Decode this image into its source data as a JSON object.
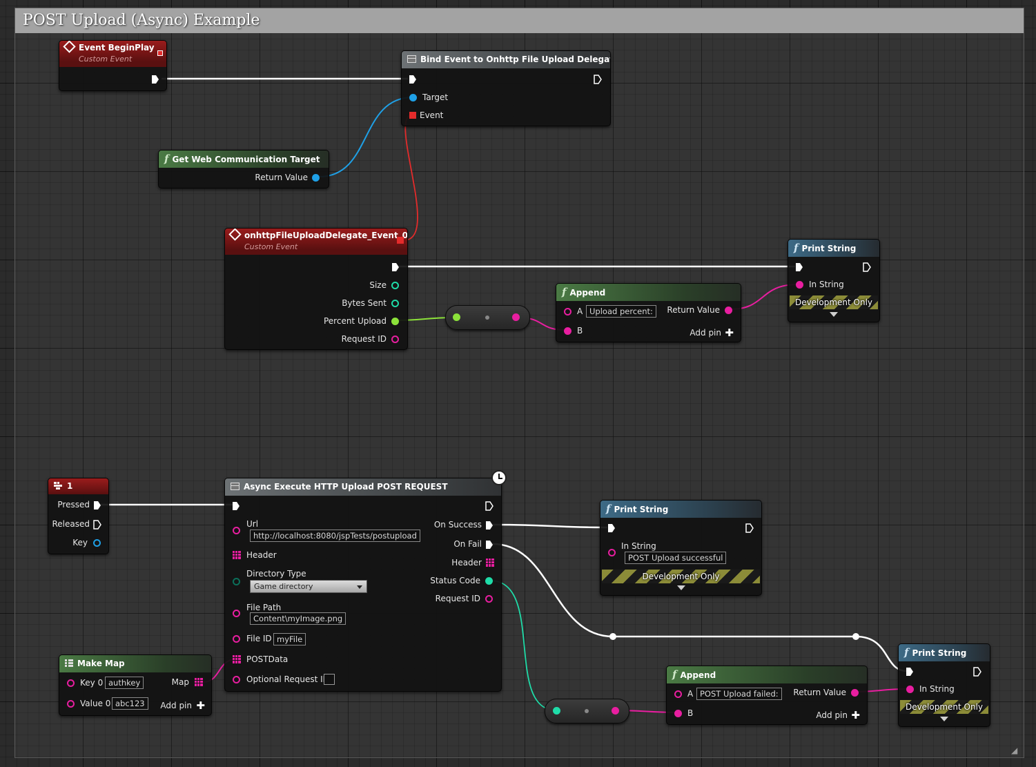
{
  "comment": {
    "title": "POST Upload (Async) Example"
  },
  "colors": {
    "exec": "#ffffff",
    "object": "#1fa0e6",
    "delegate": "#e42b2b",
    "float": "#8ce23a",
    "string": "#e81ea0",
    "integer": "#1fdca8"
  },
  "event_beginplay": {
    "title": "Event BeginPlay",
    "subtitle": "Custom Event"
  },
  "bind_event": {
    "title": "Bind Event to Onhttp File Upload Delegate",
    "target_label": "Target",
    "event_label": "Event"
  },
  "get_target": {
    "title": "Get Web Communication Target",
    "return_label": "Return Value"
  },
  "upload_event": {
    "title": "onhttpFileUploadDelegate_Event_0",
    "subtitle": "Custom Event",
    "pins": {
      "size": "Size",
      "bytes_sent": "Bytes Sent",
      "percent": "Percent Upload",
      "request_id": "Request ID"
    }
  },
  "append_top": {
    "title": "Append",
    "a_label": "A",
    "a_value": "Upload percent:",
    "b_label": "B",
    "return_label": "Return Value",
    "add_pin": "Add pin"
  },
  "print_top": {
    "title": "Print String",
    "in_string": "In String",
    "dev_only": "Development Only"
  },
  "key_event": {
    "title": "1",
    "pressed": "Pressed",
    "released": "Released",
    "key": "Key"
  },
  "async_upload": {
    "title": "Async Execute HTTP Upload POST REQUEST",
    "url_label": "Url",
    "url_value": "http://localhost:8080/jspTests/postupload",
    "header_label": "Header",
    "dir_label": "Directory Type",
    "dir_value": "Game directory",
    "file_path_label": "File Path",
    "file_path_value": "Content\\myImage.png",
    "file_id_label": "File ID",
    "file_id_value": "myFile",
    "postdata_label": "POSTData",
    "opt_req_label": "Optional Request ID",
    "out": {
      "success": "On Success",
      "fail": "On Fail",
      "header": "Header",
      "status": "Status Code",
      "request_id": "Request ID"
    }
  },
  "print_success": {
    "title": "Print String",
    "in_string": "In String",
    "value": "POST Upload successful",
    "dev_only": "Development Only"
  },
  "make_map": {
    "title": "Make Map",
    "key_label": "Key 0",
    "key_value": "authkey",
    "value_label": "Value 0",
    "value_value": "abc123",
    "map_label": "Map",
    "add_pin": "Add pin"
  },
  "append_bottom": {
    "title": "Append",
    "a_label": "A",
    "a_value": "POST Upload failed:",
    "b_label": "B",
    "return_label": "Return Value",
    "add_pin": "Add pin"
  },
  "print_fail": {
    "title": "Print String",
    "in_string": "In String",
    "dev_only": "Development Only"
  }
}
